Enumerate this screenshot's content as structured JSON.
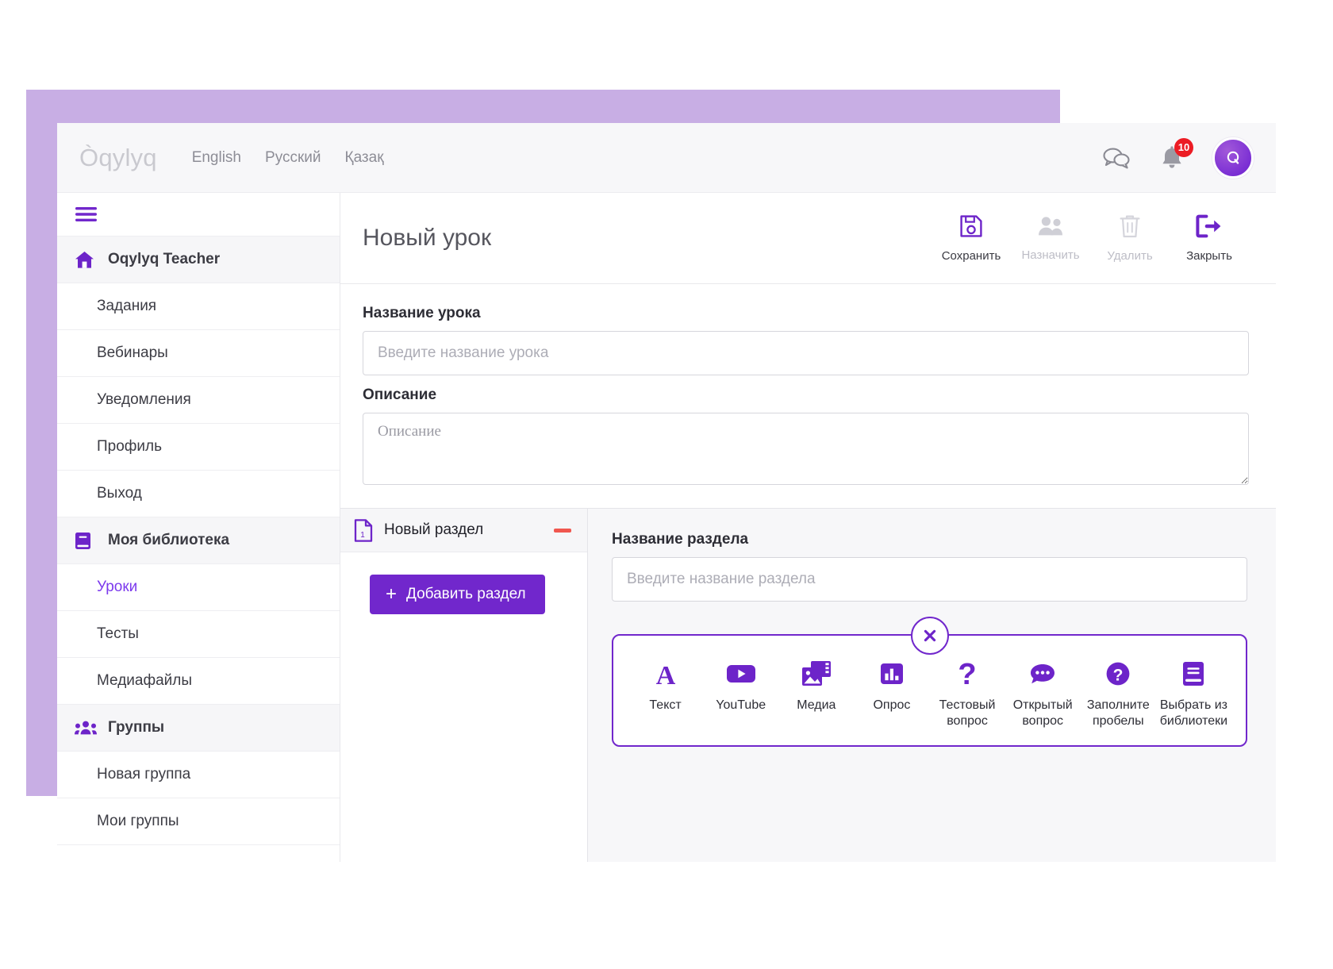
{
  "topbar": {
    "brand": "Òqylyq",
    "languages": [
      "English",
      "Русский",
      "Қазақ"
    ],
    "chat_icon": "chat-bubbles-icon",
    "bell_icon": "bell-icon",
    "notification_count": "10",
    "avatar_letter": "Q"
  },
  "sidebar": {
    "menu_icon": "hamburger-icon",
    "items": [
      {
        "label": "Oqylyq Teacher",
        "icon": "home-icon",
        "type": "header"
      },
      {
        "label": "Задания",
        "type": "child"
      },
      {
        "label": "Вебинары",
        "type": "child"
      },
      {
        "label": "Уведомления",
        "type": "child"
      },
      {
        "label": "Профиль",
        "type": "child"
      },
      {
        "label": "Выход",
        "type": "child"
      },
      {
        "label": "Моя библиотека",
        "icon": "book-icon",
        "type": "header"
      },
      {
        "label": "Уроки",
        "type": "child",
        "active": true
      },
      {
        "label": "Тесты",
        "type": "child"
      },
      {
        "label": "Медиафайлы",
        "type": "child"
      },
      {
        "label": "Группы",
        "icon": "group-icon",
        "type": "header"
      },
      {
        "label": "Новая группа",
        "type": "child"
      },
      {
        "label": "Мои группы",
        "type": "child"
      }
    ]
  },
  "content": {
    "page_title": "Новый урок",
    "actions": [
      {
        "label": "Сохранить",
        "icon": "save-icon",
        "enabled": true
      },
      {
        "label": "Назначить",
        "icon": "assign-people-icon",
        "enabled": false
      },
      {
        "label": "Удалить",
        "icon": "trash-icon",
        "enabled": false
      },
      {
        "label": "Закрыть",
        "icon": "exit-icon",
        "enabled": true
      }
    ],
    "lesson_title_label": "Название урока",
    "lesson_title_placeholder": "Введите название урока",
    "lesson_title_value": "",
    "description_label": "Описание",
    "description_placeholder": "Описание",
    "description_value": ""
  },
  "sections": {
    "section_name": "Новый раздел",
    "section_icon": "document-1-icon",
    "remove_icon": "minus-icon",
    "add_button_label": "Добавить раздел",
    "add_button_icon": "plus-icon"
  },
  "section_editor": {
    "name_label": "Название раздела",
    "name_placeholder": "Введите название раздела",
    "name_value": "",
    "close_picker_icon": "close-x-icon",
    "blocks": [
      {
        "label": "Текст",
        "icon": "text-a-icon"
      },
      {
        "label": "YouTube",
        "icon": "youtube-icon"
      },
      {
        "label": "Медиа",
        "icon": "media-image-icon"
      },
      {
        "label": "Опрос",
        "icon": "poll-bar-chart-icon"
      },
      {
        "label": "Тестовый вопрос",
        "icon": "question-mark-icon"
      },
      {
        "label": "Открытый вопрос",
        "icon": "speech-bubble-dots-icon"
      },
      {
        "label": "Заполните пробелы",
        "icon": "question-circle-icon"
      },
      {
        "label": "Выбрать из библиотеки",
        "icon": "library-book-icon"
      }
    ]
  },
  "colors": {
    "accent": "#7127cc",
    "accent_light": "#c8aee4",
    "badge": "#ec1c24",
    "danger": "#f0574f",
    "link_active": "#7c3aed"
  }
}
